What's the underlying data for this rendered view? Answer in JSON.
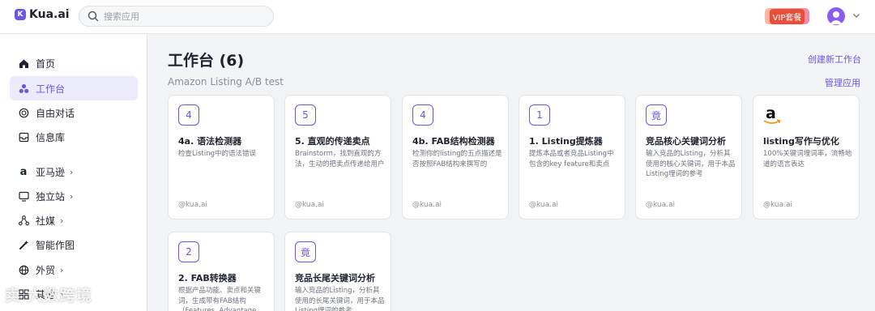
{
  "header": {
    "logo_mark": "K",
    "logo_text": "Kua.ai",
    "search_placeholder": "搜索应用",
    "vip_label": "VIP套餐"
  },
  "sidebar": {
    "items": [
      {
        "label": "首页",
        "icon": "home-icon"
      },
      {
        "label": "工作台",
        "icon": "workspace-icon",
        "active": true
      },
      {
        "label": "自由对话",
        "icon": "chat-icon"
      },
      {
        "label": "信息库",
        "icon": "inbox-icon"
      },
      {
        "label": "亚马逊",
        "icon": "amazon-icon"
      },
      {
        "label": "独立站",
        "icon": "monitor-icon"
      },
      {
        "label": "社媒",
        "icon": "social-icon"
      },
      {
        "label": "智能作图",
        "icon": "magic-icon"
      },
      {
        "label": "外贸",
        "icon": "globe-icon"
      },
      {
        "label": "其他",
        "icon": "grid-icon"
      }
    ]
  },
  "main": {
    "title": "工作台 (6)",
    "subtitle": "Amazon Listing A/B test",
    "create_link": "创建新工作台",
    "manage_link": "管理应用",
    "cards": [
      {
        "badge": "4",
        "title": "4a. 语法检测器",
        "desc": "检查Listing中的语法错误",
        "author": "@kua.ai"
      },
      {
        "badge": "5",
        "title": "5. 直观的传递卖点",
        "desc": "Brainstorm，找到直观的方法，生动的把卖点传递给用户",
        "author": "@kua.ai"
      },
      {
        "badge": "4",
        "title": "4b. FAB结构检测器",
        "desc": "检测你的listing的五点描述是否按照FAB结构来撰写的",
        "author": "@kua.ai"
      },
      {
        "badge": "1",
        "title": "1. Listing提炼器",
        "desc": "提炼本品或者竞品Listing中包含的key feature和卖点",
        "author": "@kua.ai"
      },
      {
        "badge": "竟",
        "title": "竞品核心关键词分析",
        "desc": "输入竞品的Listing，分析其使用的核心关键词，用于本品Listing埋词的参考",
        "author": "@kua.ai"
      },
      {
        "badge": "a",
        "title": "listing写作与优化",
        "desc": "100%关键词埋词率，流畅地道的语言表达",
        "author": "@kua.ai"
      },
      {
        "badge": "2",
        "title": "2. FAB转换器",
        "desc": "根据产品功能、卖点和关键词，生成带有FAB结构（Features, Advantage",
        "author": ""
      },
      {
        "badge": "竟",
        "title": "竞品长尾关键词分析",
        "desc": "输入竞品的Listing，分析其使用的长尾关键词，用于本品Listing埋词的参考",
        "author": ""
      }
    ]
  },
  "watermark": "卖 大数跨境",
  "colors": {
    "accent": "#6b55e6",
    "vip_red": "#e84f3a"
  }
}
